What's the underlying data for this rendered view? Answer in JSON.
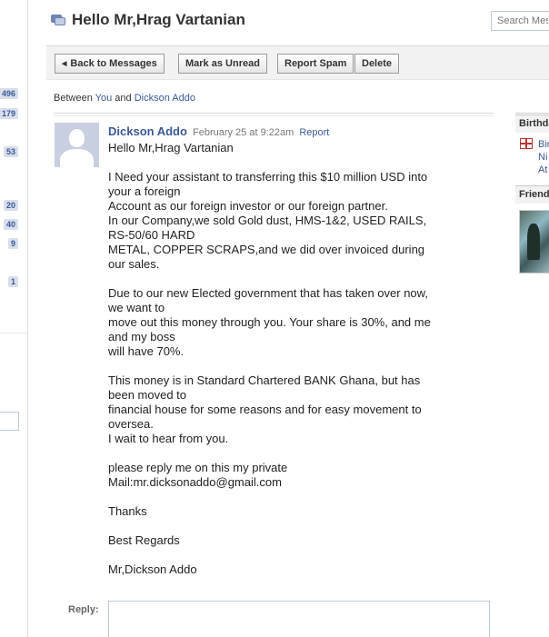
{
  "left_sidebar": {
    "counts": [
      "496",
      "179",
      "53",
      "20",
      "40",
      "9",
      "1"
    ]
  },
  "header": {
    "title": "Hello Mr,Hrag Vartanian",
    "search_placeholder": "Search Messages"
  },
  "toolbar": {
    "back_label": "Back to Messages",
    "mark_unread_label": "Mark as Unread",
    "report_spam_label": "Report Spam",
    "delete_label": "Delete"
  },
  "participants": {
    "prefix": "Between",
    "you": "You",
    "and": "and",
    "other": "Dickson Addo"
  },
  "message": {
    "sender": "Dickson Addo",
    "date": "February 25 at 9:22am",
    "report_label": "Report",
    "lines": [
      "Hello Mr,Hrag Vartanian",
      "",
      "I Need your assistant to transferring this $10 million USD into",
      "your a foreign",
      "Account as our foreign investor or our foreign partner.",
      "In our Company,we sold Gold dust, HMS-1&2, USED RAILS,",
      "RS-50/60 HARD",
      "METAL, COPPER SCRAPS,and we did over invoiced during",
      "our sales.",
      "",
      "Due to our new Elected government that has taken over now,",
      "we want to",
      "move out this money through you. Your share is 30%, and me",
      "and my boss",
      "will have 70%.",
      "",
      "This money is in Standard Chartered BANK Ghana, but has",
      "been moved to",
      "financial house for some reasons and for easy movement to",
      "oversea.",
      "I wait to hear from you.",
      "",
      "please reply me on this my private",
      "Mail:mr.dicksonaddo@gmail.com",
      "",
      "Thanks",
      "",
      "Best Regards",
      "",
      "Mr,Dickson Addo"
    ]
  },
  "reply": {
    "label": "Reply:"
  },
  "right_sidebar": {
    "birthdays_heading": "Birthdays",
    "birthday_lines": [
      "Bir",
      "Ni",
      "At"
    ],
    "friends_heading": "Friends"
  }
}
